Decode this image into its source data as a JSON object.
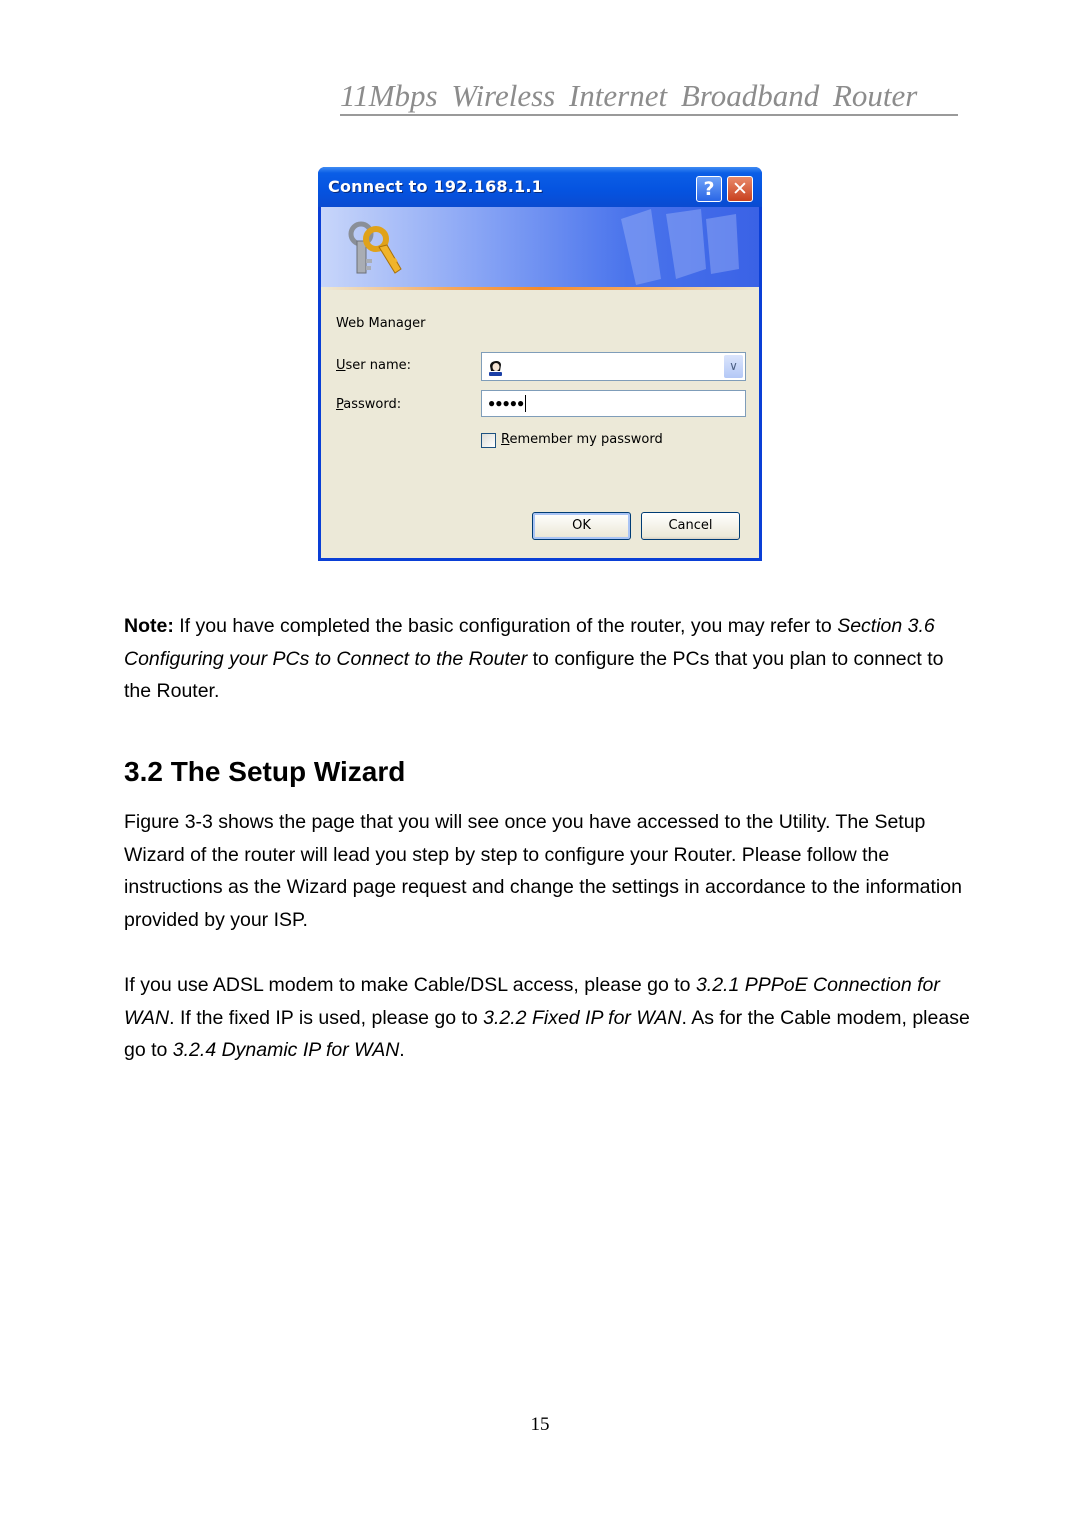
{
  "header": {
    "running_title": "11Mbps  Wireless  Internet  Broadband  Router"
  },
  "dialog": {
    "title": "Connect to 192.168.1.1",
    "help_label": "?",
    "close_label": "✕",
    "realm": "Web Manager",
    "user_label_accel": "U",
    "user_label_rest": "ser name:",
    "user_value": "",
    "password_label_accel": "P",
    "password_label_rest": "assword:",
    "password_mask": "●●●●●",
    "remember_accel": "R",
    "remember_rest": "emember my password",
    "remember_checked": false,
    "ok_label": "OK",
    "cancel_label": "Cancel",
    "icons": {
      "banner": "keys-icon",
      "user": "user-avatar-icon",
      "dropdown": "chevron-down-icon"
    }
  },
  "note": {
    "bold": "Note:",
    "text1": " If you have completed the basic configuration of the router, you may refer to ",
    "italic": "Section 3.6 Configuring your PCs to Connect to the Router",
    "text2": " to configure the PCs that you plan to connect to the Router."
  },
  "section": {
    "heading": "3.2 The Setup Wizard",
    "para1": "Figure 3-3 shows the page that you will see once you have accessed to the Utility. The Setup Wizard of the router will lead you step by step to configure your Router. Please follow the instructions as the Wizard page request and change the settings in accordance to the information provided by your ISP.",
    "para2_t1": "If you use ADSL modem to make Cable/DSL access, please go to ",
    "para2_i1": "3.2.1 PPPoE Connection for WAN",
    "para2_t2": ". If the fixed IP is used, please go to ",
    "para2_i2": "3.2.2 Fixed IP for WAN",
    "para2_t3": ". As for the Cable modem, please go to ",
    "para2_i3": "3.2.4 Dynamic IP for WAN",
    "para2_t4": "."
  },
  "footer": {
    "page_number": "15"
  }
}
